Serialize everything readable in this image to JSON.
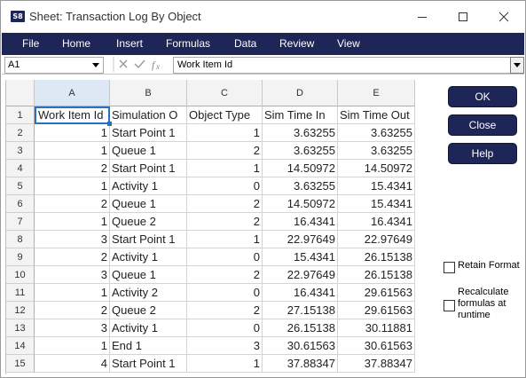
{
  "window": {
    "app_icon_text": "S8",
    "title": "Sheet: Transaction Log By Object"
  },
  "menu": [
    "File",
    "Home",
    "Insert",
    "Formulas",
    "Data",
    "Review",
    "View"
  ],
  "formula_bar": {
    "cell_ref": "A1",
    "formula_text": "Work Item Id"
  },
  "sheet": {
    "columns": [
      "A",
      "B",
      "C",
      "D",
      "E"
    ],
    "rows": [
      {
        "n": "1",
        "cells": [
          "Work Item Id",
          "Simulation O",
          "Object Type",
          "Sim Time In",
          "Sim Time Out"
        ]
      },
      {
        "n": "2",
        "cells": [
          "1",
          "Start Point 1",
          "1",
          "3.63255",
          "3.63255"
        ]
      },
      {
        "n": "3",
        "cells": [
          "1",
          "Queue 1",
          "2",
          "3.63255",
          "3.63255"
        ]
      },
      {
        "n": "4",
        "cells": [
          "2",
          "Start Point 1",
          "1",
          "14.50972",
          "14.50972"
        ]
      },
      {
        "n": "5",
        "cells": [
          "1",
          "Activity 1",
          "0",
          "3.63255",
          "15.4341"
        ]
      },
      {
        "n": "6",
        "cells": [
          "2",
          "Queue 1",
          "2",
          "14.50972",
          "15.4341"
        ]
      },
      {
        "n": "7",
        "cells": [
          "1",
          "Queue 2",
          "2",
          "16.4341",
          "16.4341"
        ]
      },
      {
        "n": "8",
        "cells": [
          "3",
          "Start Point 1",
          "1",
          "22.97649",
          "22.97649"
        ]
      },
      {
        "n": "9",
        "cells": [
          "2",
          "Activity 1",
          "0",
          "15.4341",
          "26.15138"
        ]
      },
      {
        "n": "10",
        "cells": [
          "3",
          "Queue 1",
          "2",
          "22.97649",
          "26.15138"
        ]
      },
      {
        "n": "11",
        "cells": [
          "1",
          "Activity 2",
          "0",
          "16.4341",
          "29.61563"
        ]
      },
      {
        "n": "12",
        "cells": [
          "2",
          "Queue 2",
          "2",
          "27.15138",
          "29.61563"
        ]
      },
      {
        "n": "13",
        "cells": [
          "3",
          "Activity 1",
          "0",
          "26.15138",
          "30.11881"
        ]
      },
      {
        "n": "14",
        "cells": [
          "1",
          "End 1",
          "3",
          "30.61563",
          "30.61563"
        ]
      },
      {
        "n": "15",
        "cells": [
          "4",
          "Start Point 1",
          "1",
          "37.88347",
          "37.88347"
        ]
      }
    ]
  },
  "buttons": {
    "ok": "OK",
    "close": "Close",
    "help": "Help"
  },
  "options": {
    "retain_format": "Retain Format",
    "recalculate_line1": "Recalculate",
    "recalculate_line2": "formulas at",
    "recalculate_line3": "runtime"
  },
  "colors": {
    "accent": "#1e2557",
    "selection": "#2572c4"
  }
}
